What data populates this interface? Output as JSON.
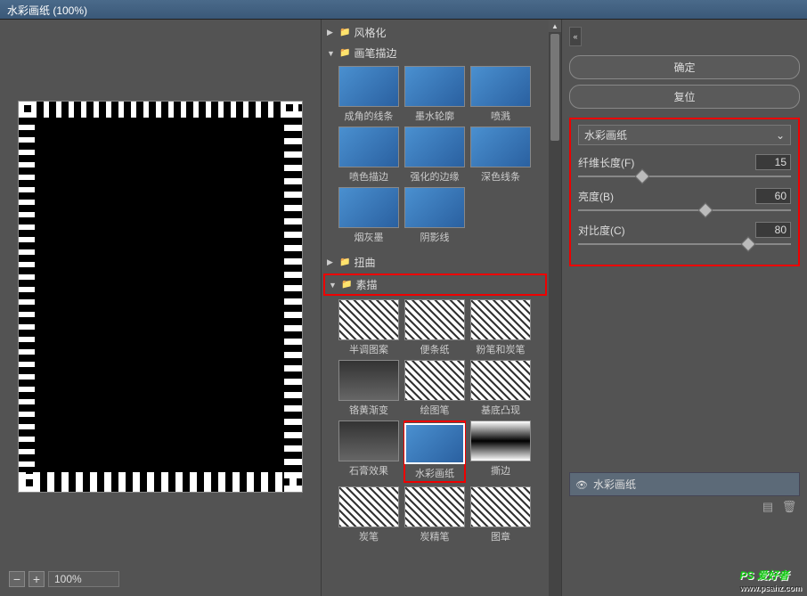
{
  "window": {
    "title": "水彩画纸 (100%)"
  },
  "preview": {
    "zoom_minus": "−",
    "zoom_plus": "+",
    "zoom_value": "100%"
  },
  "categories": [
    {
      "label": "风格化",
      "expanded": false,
      "highlight": false,
      "mode": "color"
    },
    {
      "label": "画笔描边",
      "expanded": true,
      "highlight": false,
      "mode": "color",
      "thumbs": [
        "成角的线条",
        "墨水轮廓",
        "喷溅",
        "喷色描边",
        "强化的边缘",
        "深色线条",
        "烟灰墨",
        "阴影线"
      ]
    },
    {
      "label": "扭曲",
      "expanded": false,
      "highlight": false,
      "mode": "color"
    },
    {
      "label": "素描",
      "expanded": true,
      "highlight": true,
      "mode": "sketch",
      "thumbs": [
        "半调图案",
        "便条纸",
        "粉笔和炭笔",
        "铬黄渐变",
        "绘图笔",
        "基底凸现",
        "石膏效果",
        "水彩画纸",
        "撕边",
        "炭笔",
        "炭精笔",
        "图章"
      ],
      "selected": "水彩画纸"
    }
  ],
  "buttons": {
    "ok": "确定",
    "reset": "复位"
  },
  "settings": {
    "filter_name": "水彩画纸",
    "sliders": [
      {
        "label": "纤维长度(F)",
        "value": "15",
        "pct": 30
      },
      {
        "label": "亮度(B)",
        "value": "60",
        "pct": 60
      },
      {
        "label": "对比度(C)",
        "value": "80",
        "pct": 80
      }
    ]
  },
  "layers": {
    "item": "水彩画纸"
  },
  "watermark": {
    "brand": "PS 爱好者",
    "url": "www.psahz.com"
  }
}
